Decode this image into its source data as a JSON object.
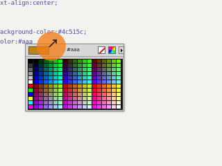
{
  "code": {
    "line1": "xt-align:center;",
    "line2": "ackground-color:#4c515c;",
    "line3": "olor:#aaa"
  },
  "color_picker": {
    "hex_value": "#aaa",
    "preview_color": "#b88412",
    "highlight_color": "#f27e18"
  },
  "icons": {
    "no_color": "no-color-icon",
    "color_wheel": "color-wheel-icon",
    "menu": "menu-arrow-icon",
    "cursor": "mouse-cursor-icon"
  }
}
